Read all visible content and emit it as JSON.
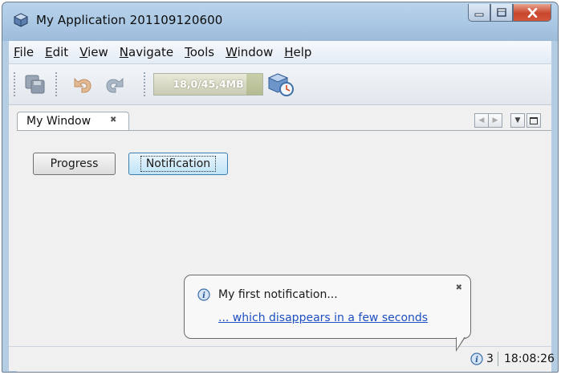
{
  "window": {
    "title": "My Application 201109120600",
    "controls": {
      "minimize": "minimize",
      "maximize": "maximize",
      "close": "close"
    }
  },
  "menubar": {
    "items": [
      {
        "label": "File",
        "mnemonic": "F",
        "rest": "ile"
      },
      {
        "label": "Edit",
        "mnemonic": "E",
        "rest": "dit"
      },
      {
        "label": "View",
        "mnemonic": "V",
        "rest": "iew"
      },
      {
        "label": "Navigate",
        "mnemonic": "N",
        "rest": "avigate"
      },
      {
        "label": "Tools",
        "mnemonic": "T",
        "rest": "ools"
      },
      {
        "label": "Window",
        "mnemonic": "W",
        "rest": "indow"
      },
      {
        "label": "Help",
        "mnemonic": "H",
        "rest": "elp"
      }
    ]
  },
  "toolbar": {
    "memory_label": "18,0/45,4MB",
    "memory_used_mb": 18.0,
    "memory_total_mb": 45.4
  },
  "editor": {
    "tab_label": "My Window",
    "buttons": {
      "progress": "Progress",
      "notification": "Notification"
    }
  },
  "notification": {
    "title": "My first notification...",
    "link": "... which disappears in a few seconds"
  },
  "statusbar": {
    "notification_count": "3",
    "time": "18:08:26"
  },
  "colors": {
    "titlebar": "#a8c6e3",
    "link": "#1e4fbf",
    "close_button": "#c8462c",
    "focused_button": "#bfe3f7"
  }
}
